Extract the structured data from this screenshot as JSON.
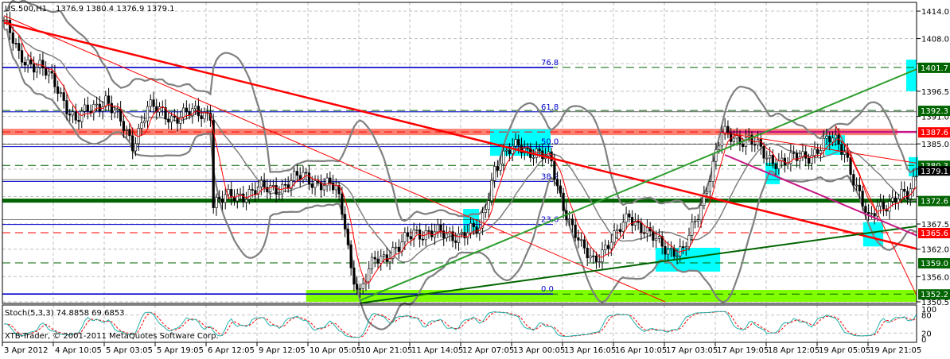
{
  "header": {
    "symbol": "US.500,H1",
    "ohlc": "1376.9 1380.4 1376.9 1379.1"
  },
  "indicator": {
    "label": "Stoch(5,3,3) 74.8858 69.6853",
    "axis_labels": [
      "100",
      "80",
      "20",
      "0"
    ]
  },
  "copyright": "XTB-Trader, © 2001-2011 MetaQuotes Software Corp.",
  "colors": {
    "candle": "#000000",
    "ma": "#ff0000",
    "bollinger": "#808080",
    "support_green": "#006400",
    "trend_green": "#2e9e2e",
    "resistance_red": "#ff0000",
    "salmon_band": "#fa8072",
    "magenta": "#c71585",
    "fib_blue": "#0000cc",
    "highlight_cyan": "#00ffff",
    "zone_lime": "#7fff00",
    "stoch_main": "#20b2aa",
    "stoch_signal": "#ff0000"
  },
  "chart_data": {
    "type": "candlestick",
    "timeframe": "H1",
    "x_tick_labels": [
      "3 Apr 2012",
      "4 Apr 10:05",
      "5 Apr 03:05",
      "5 Apr 19:05",
      "6 Apr 12:05",
      "9 Apr 12:05",
      "10 Apr 05:05",
      "10 Apr 21:05",
      "11 Apr 14:05",
      "12 Apr 07:05",
      "13 Apr 00:05",
      "13 Apr 16:05",
      "16 Apr 10:05",
      "17 Apr 03:05",
      "17 Apr 19:05",
      "18 Apr 12:05",
      "19 Apr 05:05",
      "19 Apr 21:05"
    ],
    "y_range": [
      1350.5,
      1414.0
    ],
    "y_tick_labels": [
      "1414.0",
      "1408.0",
      "1396.5",
      "1391.0",
      "1385.0",
      "1367.5",
      "1362.0",
      "1356.0",
      "1350.5"
    ],
    "current_price": "1379.1",
    "level_labels": [
      {
        "price": 1401.7,
        "text": "1401.7",
        "color": "#006400"
      },
      {
        "price": 1392.3,
        "text": "1392.3",
        "color": "#006400"
      },
      {
        "price": 1387.6,
        "text": "1387.6",
        "color": "#ff0000"
      },
      {
        "price": 1380.3,
        "text": "1380.3",
        "color": "#006400"
      },
      {
        "price": 1372.6,
        "text": "1372.6",
        "color": "#006400"
      },
      {
        "price": 1365.6,
        "text": "1365.6",
        "color": "#ff0000"
      },
      {
        "price": 1359.0,
        "text": "1359.0",
        "color": "#006400"
      },
      {
        "price": 1352.2,
        "text": "1352.2",
        "color": "#006400"
      }
    ],
    "fibonacci": [
      {
        "level": "76.8",
        "price": 1401.7
      },
      {
        "level": "61.8",
        "price": 1392.0
      },
      {
        "level": "50.0",
        "price": 1384.4
      },
      {
        "level": "38.2",
        "price": 1376.8
      },
      {
        "level": "23.6",
        "price": 1367.4
      },
      {
        "level": "0.0",
        "price": 1352.2
      }
    ],
    "approx_close_path_bar_price": [
      [
        0,
        1412
      ],
      [
        5,
        1404
      ],
      [
        12,
        1402
      ],
      [
        18,
        1397
      ],
      [
        24,
        1390
      ],
      [
        34,
        1395
      ],
      [
        43,
        1385
      ],
      [
        48,
        1393
      ],
      [
        56,
        1391
      ],
      [
        69,
        1392
      ],
      [
        70,
        1372
      ],
      [
        79,
        1374
      ],
      [
        94,
        1376
      ],
      [
        100,
        1378
      ],
      [
        111,
        1375
      ],
      [
        114,
        1368
      ],
      [
        116,
        1358
      ],
      [
        119,
        1352
      ],
      [
        124,
        1360
      ],
      [
        132,
        1362
      ],
      [
        137,
        1366
      ],
      [
        148,
        1365
      ],
      [
        159,
        1366
      ],
      [
        164,
        1380
      ],
      [
        172,
        1385
      ],
      [
        183,
        1381
      ],
      [
        185,
        1376
      ],
      [
        189,
        1368
      ],
      [
        193,
        1362
      ],
      [
        197,
        1360
      ],
      [
        204,
        1364
      ],
      [
        209,
        1370
      ],
      [
        215,
        1365
      ],
      [
        223,
        1362
      ],
      [
        227,
        1361
      ],
      [
        231,
        1368
      ],
      [
        235,
        1376
      ],
      [
        240,
        1387
      ],
      [
        249,
        1386
      ],
      [
        255,
        1382
      ],
      [
        262,
        1381
      ],
      [
        270,
        1383
      ],
      [
        277,
        1386
      ],
      [
        281,
        1384
      ],
      [
        285,
        1375
      ],
      [
        289,
        1368
      ],
      [
        292,
        1372
      ],
      [
        297,
        1372
      ],
      [
        302,
        1374
      ],
      [
        305,
        1379
      ]
    ],
    "trend_lines": [
      {
        "from": [
          0,
          1411.5
        ],
        "to": [
          305,
          1362.1
        ],
        "color": "#ff0000",
        "weight": "thick"
      },
      {
        "from": [
          0,
          1413.0
        ],
        "to": [
          221,
          1350.5
        ],
        "color": "#ff0000",
        "weight": "thin"
      },
      {
        "from": [
          239,
          1387.6
        ],
        "to": [
          305,
          1380.8
        ],
        "color": "#ff0000",
        "weight": "thin"
      },
      {
        "from": [
          278,
          1389.0
        ],
        "to": [
          305,
          1352.0
        ],
        "color": "#ff0000",
        "weight": "thin"
      },
      {
        "from": [
          119,
          1350.8
        ],
        "to": [
          305,
          1401.3
        ],
        "color": "#2e9e2e",
        "weight": "medium"
      },
      {
        "from": [
          119,
          1350.2
        ],
        "to": [
          305,
          1367.0
        ],
        "color": "#006400",
        "weight": "medium"
      },
      {
        "from": [
          241,
          1382.6
        ],
        "to": [
          305,
          1365.0
        ],
        "color": "#c71585",
        "weight": "medium"
      }
    ],
    "highlight_boxes_bar_price": [
      [
        162.5,
        182.7,
        1388.2,
        1382.4
      ],
      [
        153.5,
        158.8,
        1370.8,
        1365.8
      ],
      [
        217.8,
        239.4,
        1362.3,
        1357.1
      ],
      [
        254.5,
        259.3,
        1380.9,
        1376.2
      ],
      [
        274.5,
        281.1,
        1386.9,
        1382.6
      ],
      [
        287.2,
        293.9,
        1367.9,
        1362.6
      ],
      [
        301.6,
        305.0,
        1403.4,
        1396.5
      ],
      [
        302.4,
        305.6,
        1382.1,
        1377.9
      ]
    ],
    "zone_bar_price": [
      101,
      305.6,
      1353.1,
      1350.5
    ]
  }
}
